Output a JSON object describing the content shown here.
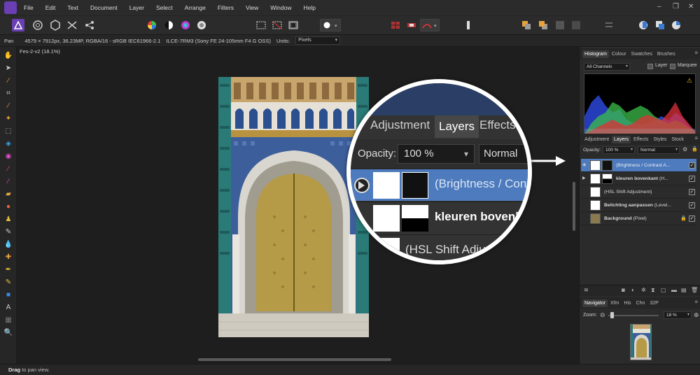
{
  "menubar": {
    "items": [
      "File",
      "Edit",
      "Text",
      "Document",
      "Layer",
      "Select",
      "Arrange",
      "Filters",
      "View",
      "Window",
      "Help"
    ]
  },
  "toolbar": {
    "icons": [
      "photo-persona-icon",
      "liquify-persona-icon",
      "develop-persona-icon",
      "tone-mapping-persona-icon",
      "export-persona-icon"
    ]
  },
  "contextbar": {
    "tool": "Pan",
    "image_info": "4579 × 7912px, 36.23MP, RGBA/16 - sRGB IEC61966-2.1",
    "camera": "ILCE-7RM3 (Sony FE 24-105mm F4 G OSS)",
    "units_label": "Units:",
    "units_value": "Pixels"
  },
  "document": {
    "tab_label": "Fes-2-v2 (18.1%)"
  },
  "status": {
    "bold": "Drag",
    "rest": "to pan view."
  },
  "histogram_panel": {
    "tabs": [
      "Histogram",
      "Colour",
      "Swatches",
      "Brushes"
    ],
    "active_tab": "Histogram",
    "channel_select": "All Channels",
    "layer_label": "Layer",
    "marquee_label": "Marquee"
  },
  "layers_panel": {
    "tabs": [
      "Adjustment",
      "Layers",
      "Effects",
      "Styles",
      "Stock"
    ],
    "active_tab": "Layers",
    "opacity_label": "Opacity:",
    "opacity_value": "100 %",
    "blend_mode": "Normal",
    "layers": [
      {
        "name": "(Brightness / Contrast A...",
        "selected": true,
        "bold": false,
        "expandable": true,
        "locked": false
      },
      {
        "name": "kleuren bovenkant",
        "suffix": "(H...",
        "selected": false,
        "bold": true,
        "expandable": true,
        "locked": false
      },
      {
        "name": "(HSL Shift Adjustment)",
        "selected": false,
        "bold": false,
        "expandable": false,
        "locked": false
      },
      {
        "name": "Belichting aanpassen",
        "suffix": "(Level...",
        "selected": false,
        "bold": true,
        "expandable": false,
        "locked": false
      },
      {
        "name": "Background",
        "suffix": "(Pixel)",
        "selected": false,
        "bold": true,
        "expandable": false,
        "locked": true
      }
    ]
  },
  "navigator_panel": {
    "tabs": [
      "Navigator",
      "Xfm",
      "His",
      "Chn",
      "32P"
    ],
    "active_tab": "Navigator",
    "zoom_label": "Zoom:",
    "zoom_value": "18 %"
  },
  "magnifier": {
    "tabs": [
      "Adjustment",
      "Layers",
      "Effects"
    ],
    "active_tab": "Layers",
    "opacity_label": "Opacity:",
    "opacity_value": "100 %",
    "blend_mode": "Normal",
    "row1": "(Brightness / Contrast",
    "row2": "kleuren bovenkant",
    "row3": "(HSL Shift Adjustment"
  },
  "colors": {
    "accent": "#4e7bbd",
    "persona": "#6a3fb3"
  }
}
